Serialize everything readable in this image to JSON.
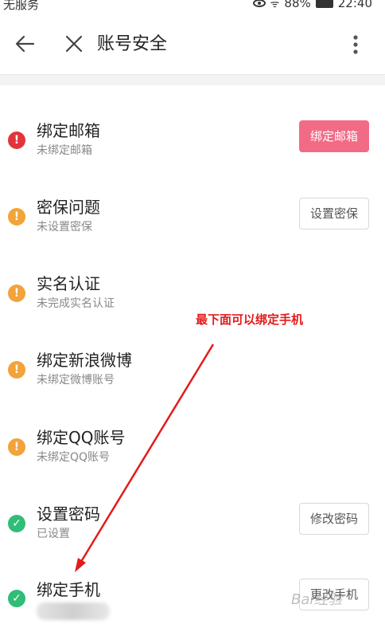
{
  "status_bar": {
    "carrier": "无服务",
    "battery": "88%",
    "time": "22:40"
  },
  "app_bar": {
    "title": "账号安全"
  },
  "items": [
    {
      "title": "绑定邮箱",
      "subtitle": "未绑定邮箱",
      "status": "error",
      "button": "绑定邮箱",
      "button_style": "primary"
    },
    {
      "title": "密保问题",
      "subtitle": "未设置密保",
      "status": "warning",
      "button": "设置密保",
      "button_style": "outline"
    },
    {
      "title": "实名认证",
      "subtitle": "未完成实名认证",
      "status": "warning",
      "button": "",
      "button_style": ""
    },
    {
      "title": "绑定新浪微博",
      "subtitle": "未绑定微博账号",
      "status": "warning",
      "button": "",
      "button_style": ""
    },
    {
      "title": "绑定QQ账号",
      "subtitle": "未绑定QQ账号",
      "status": "warning",
      "button": "",
      "button_style": ""
    },
    {
      "title": "设置密码",
      "subtitle": "已设置",
      "status": "ok",
      "button": "修改密码",
      "button_style": "outline"
    },
    {
      "title": "绑定手机",
      "subtitle": "",
      "status": "ok",
      "button": "更改手机",
      "button_style": "outline"
    }
  ],
  "annotation": {
    "text": "最下面可以绑定手机"
  },
  "colors": {
    "error": "#e1353c",
    "warning": "#f2a339",
    "ok": "#2fbd78",
    "primary_button": "#f26b86",
    "annotation": "#e31b1b"
  },
  "watermark": "Bai经验"
}
